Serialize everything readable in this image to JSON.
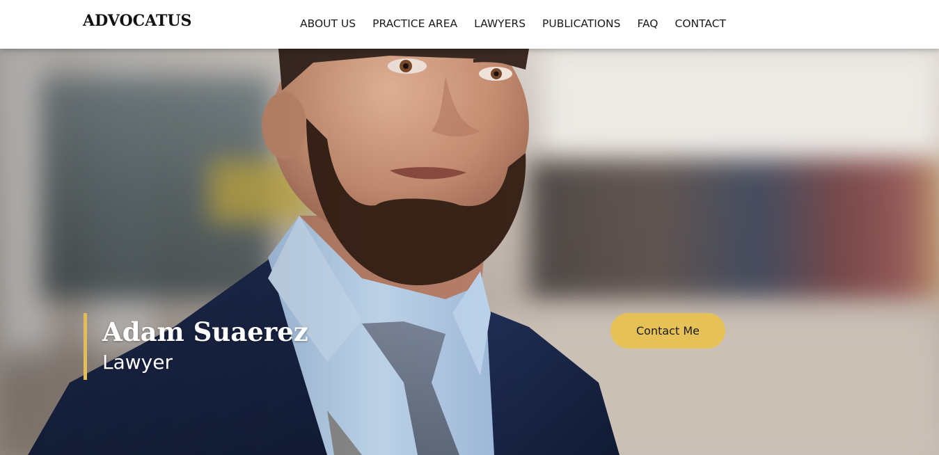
{
  "brand": {
    "logo_text": "ADVOCATUS"
  },
  "nav": {
    "items": [
      {
        "label": "ABOUT US"
      },
      {
        "label": "PRACTICE AREA"
      },
      {
        "label": "LAWYERS"
      },
      {
        "label": "PUBLICATIONS"
      },
      {
        "label": "FAQ"
      },
      {
        "label": "CONTACT"
      }
    ]
  },
  "hero": {
    "name": "Adam Suaerez",
    "title": "Lawyer",
    "cta_label": "Contact Me",
    "image_subject": "bearded-man-in-suit-portrait"
  },
  "colors": {
    "accent": "#e5c158",
    "accent_bar": "#e2bd59",
    "nav_bg": "#ffffff",
    "nav_text": "#1a1a1a",
    "hero_text": "#ffffff",
    "jacket": "#1c2a4d",
    "shirt": "#b8d2ec",
    "tie": "#6c7787"
  }
}
